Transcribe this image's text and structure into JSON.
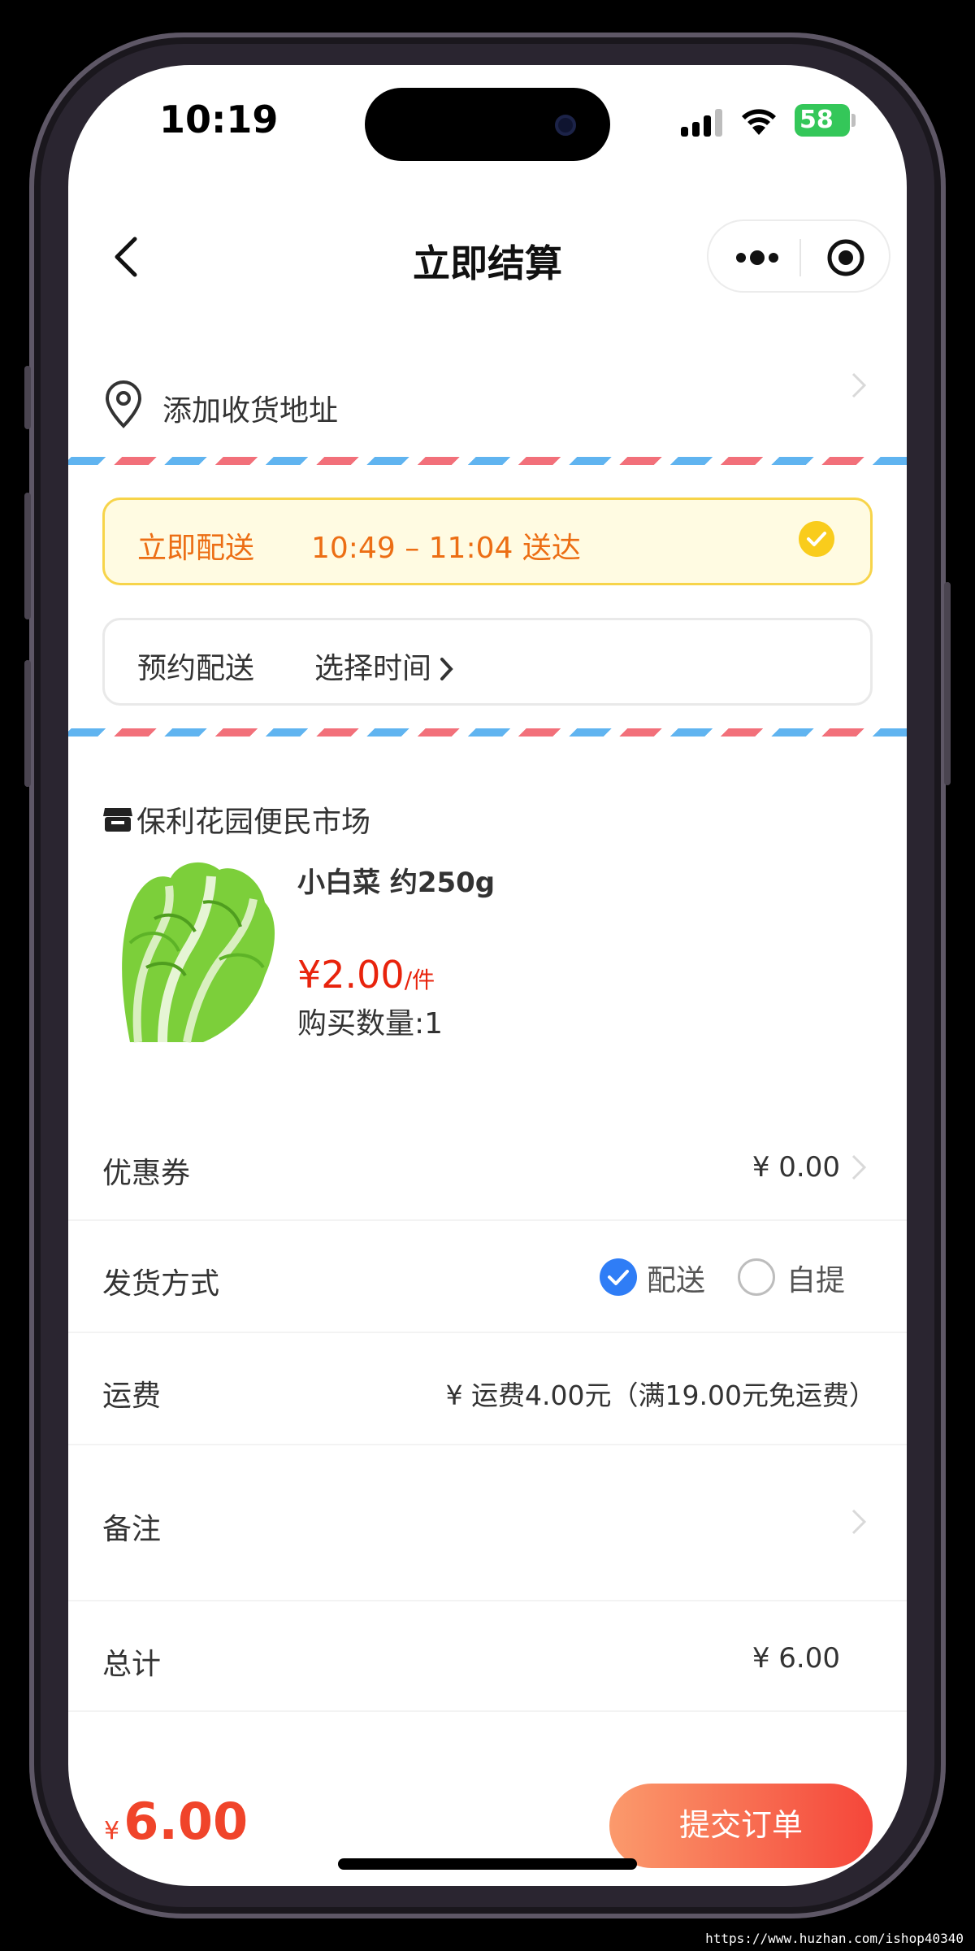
{
  "status_bar": {
    "time": "10:19",
    "battery": "58"
  },
  "nav": {
    "title": "立即结算"
  },
  "address": {
    "label": "添加收货地址"
  },
  "delivery": {
    "now_label": "立即配送",
    "now_time": "10:49 – 11:04 送达",
    "scheduled_label": "预约配送",
    "scheduled_value": "选择时间"
  },
  "store": {
    "name": "保利花园便民市场"
  },
  "product": {
    "name": "小白菜 约250g",
    "price": "¥2.00",
    "unit": "/件",
    "quantity": "购买数量:1"
  },
  "rows": {
    "coupon_label": "优惠券",
    "coupon_value": "¥ 0.00",
    "shipping_method_label": "发货方式",
    "shipping_option_delivery": "配送",
    "shipping_option_pickup": "自提",
    "shipping_method_selected": "配送",
    "freight_label": "运费",
    "freight_value": "¥ 运费4.00元（满19.00元免运费）",
    "note_label": "备注",
    "total_label": "总计",
    "total_value": "¥ 6.00"
  },
  "footer": {
    "currency": "¥",
    "total": "6.00",
    "submit_label": "提交订单"
  },
  "watermark": "https://www.huzhan.com/ishop40340",
  "colors": {
    "accent_orange": "#ec6e14",
    "price_red": "#e8230c",
    "radio_blue": "#2f7df6",
    "highlight_yellow": "#f9cc1c"
  }
}
